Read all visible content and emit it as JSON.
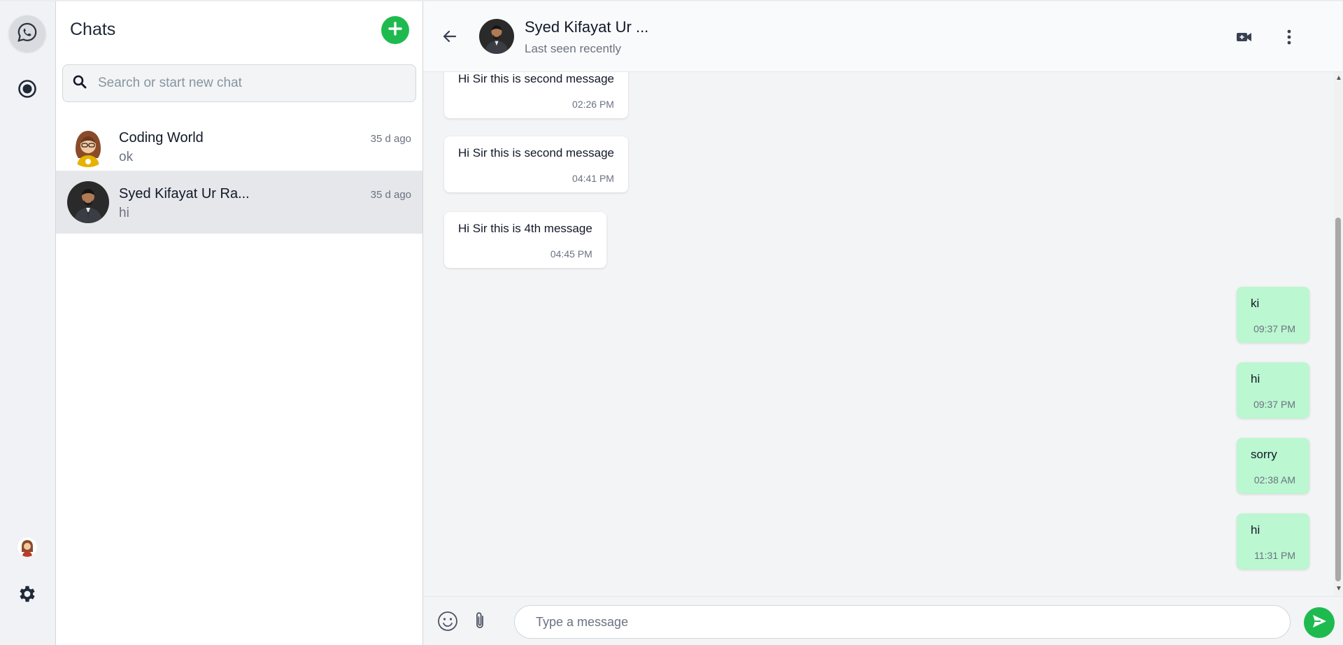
{
  "sidebar": {
    "title": "Chats",
    "search_placeholder": "Search or start new chat"
  },
  "chats": [
    {
      "name": "Coding World",
      "last_message": "ok",
      "time": "35 d ago",
      "selected": false
    },
    {
      "name": "Syed Kifayat Ur Ra...",
      "last_message": "hi",
      "time": "35 d ago",
      "selected": true
    }
  ],
  "conversation": {
    "contact_name": "Syed Kifayat Ur ...",
    "status": "Last seen recently",
    "messages": [
      {
        "direction": "incoming",
        "text": "Hi Sir this is second message",
        "time": "02:26 PM"
      },
      {
        "direction": "incoming",
        "text": "Hi Sir this is second message",
        "time": "04:41 PM"
      },
      {
        "direction": "incoming",
        "text": "Hi Sir this is 4th message",
        "time": "04:45 PM"
      },
      {
        "direction": "outgoing",
        "text": "ki",
        "time": "09:37 PM"
      },
      {
        "direction": "outgoing",
        "text": "hi",
        "time": "09:37 PM"
      },
      {
        "direction": "outgoing",
        "text": "sorry",
        "time": "02:38 AM"
      },
      {
        "direction": "outgoing",
        "text": "hi",
        "time": "11:31 PM"
      }
    ],
    "input_placeholder": "Type a message"
  },
  "icons": {
    "rail": [
      "whatsapp-icon",
      "status-icon",
      "profile-avatar",
      "gear-icon"
    ],
    "header": [
      "back-arrow-icon",
      "video-camera-icon",
      "more-vertical-icon"
    ],
    "composer": [
      "emoji-icon",
      "paperclip-icon",
      "send-icon"
    ]
  },
  "colors": {
    "accent": "#1fba4f",
    "outgoing_bubble": "#bbf7d0",
    "incoming_bubble": "#ffffff",
    "selected_chat": "#e5e7eb",
    "rail_background": "#f0f2f5"
  }
}
